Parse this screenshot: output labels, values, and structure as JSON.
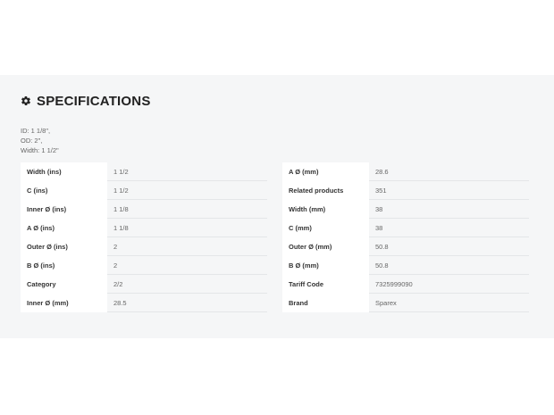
{
  "heading": {
    "icon": "gear-icon",
    "title": "SPECIFICATIONS"
  },
  "summary": {
    "lines": [
      "ID: 1 1/8\",",
      "OD: 2\",",
      "Width: 1 1/2\""
    ]
  },
  "left_table": {
    "rows": [
      {
        "label": "Width (ins)",
        "value": "1 1/2"
      },
      {
        "label": "C (ins)",
        "value": "1 1/2"
      },
      {
        "label": "Inner Ø (ins)",
        "value": "1 1/8"
      },
      {
        "label": "A Ø (ins)",
        "value": "1 1/8"
      },
      {
        "label": "Outer Ø (ins)",
        "value": "2"
      },
      {
        "label": "B Ø (ins)",
        "value": "2"
      },
      {
        "label": "Category",
        "value": "2/2"
      },
      {
        "label": "Inner Ø (mm)",
        "value": "28.5"
      }
    ]
  },
  "right_table": {
    "rows": [
      {
        "label": "A Ø (mm)",
        "value": "28.6"
      },
      {
        "label": "Related products",
        "value": "351"
      },
      {
        "label": "Width (mm)",
        "value": "38"
      },
      {
        "label": "C (mm)",
        "value": "38"
      },
      {
        "label": "Outer Ø (mm)",
        "value": "50.8"
      },
      {
        "label": "B Ø (mm)",
        "value": "50.8"
      },
      {
        "label": "Tariff Code",
        "value": "7325999090"
      },
      {
        "label": "Brand",
        "value": "Sparex"
      }
    ]
  },
  "colors": {
    "section_background": "#f5f6f7",
    "heading_text": "#222222",
    "row_border": "#e4e6e8"
  }
}
